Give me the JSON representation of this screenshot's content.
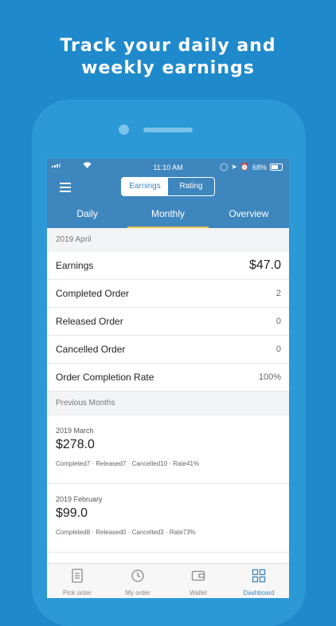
{
  "headline": {
    "line1": "Track your daily and",
    "line2": "weekly earnings"
  },
  "statusbar": {
    "time": "11:10 AM",
    "battery": "68%"
  },
  "header": {
    "segments": [
      "Earnings",
      "Rating"
    ],
    "tabs": [
      "Daily",
      "Monthly",
      "Overview"
    ]
  },
  "current": {
    "period": "2019 April",
    "rows": [
      {
        "label": "Earnings",
        "value": "$47.0"
      },
      {
        "label": "Completed Order",
        "value": "2"
      },
      {
        "label": "Released Order",
        "value": "0"
      },
      {
        "label": "Cancelled Order",
        "value": "0"
      },
      {
        "label": "Order Completion Rate",
        "value": "100%"
      }
    ]
  },
  "previous": {
    "title": "Previous Months",
    "months": [
      {
        "name": "2019 March",
        "amount": "$278.0",
        "stats": "Completed7 · Released7 · Cancelled10 · Rate41%"
      },
      {
        "name": "2019 February",
        "amount": "$99.0",
        "stats": "Completed8 · Released0 · Cancelled3 · Rate73%"
      }
    ]
  },
  "tabbar": {
    "items": [
      "Pick order",
      "My order",
      "Wallet",
      "Dashboard"
    ]
  },
  "colors": {
    "background": "#1f8acb",
    "primary": "#3e86be",
    "tab_indicator": "#e8c24a"
  }
}
